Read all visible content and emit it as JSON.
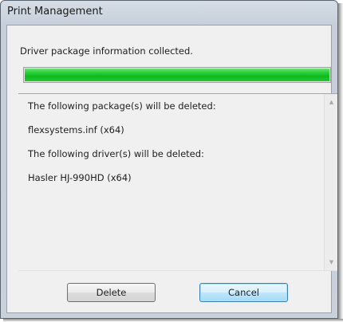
{
  "window": {
    "title": "Print Management"
  },
  "status": {
    "message": "Driver package information collected.",
    "progress_percent": 100,
    "progress_color": "#21c92f"
  },
  "details": {
    "lines": [
      "The following package(s) will be deleted:",
      "flexsystems.inf (x64)",
      "The following driver(s) will be deleted:",
      "Hasler HJ-990HD (x64)"
    ]
  },
  "buttons": {
    "delete_label": "Delete",
    "cancel_label": "Cancel"
  }
}
